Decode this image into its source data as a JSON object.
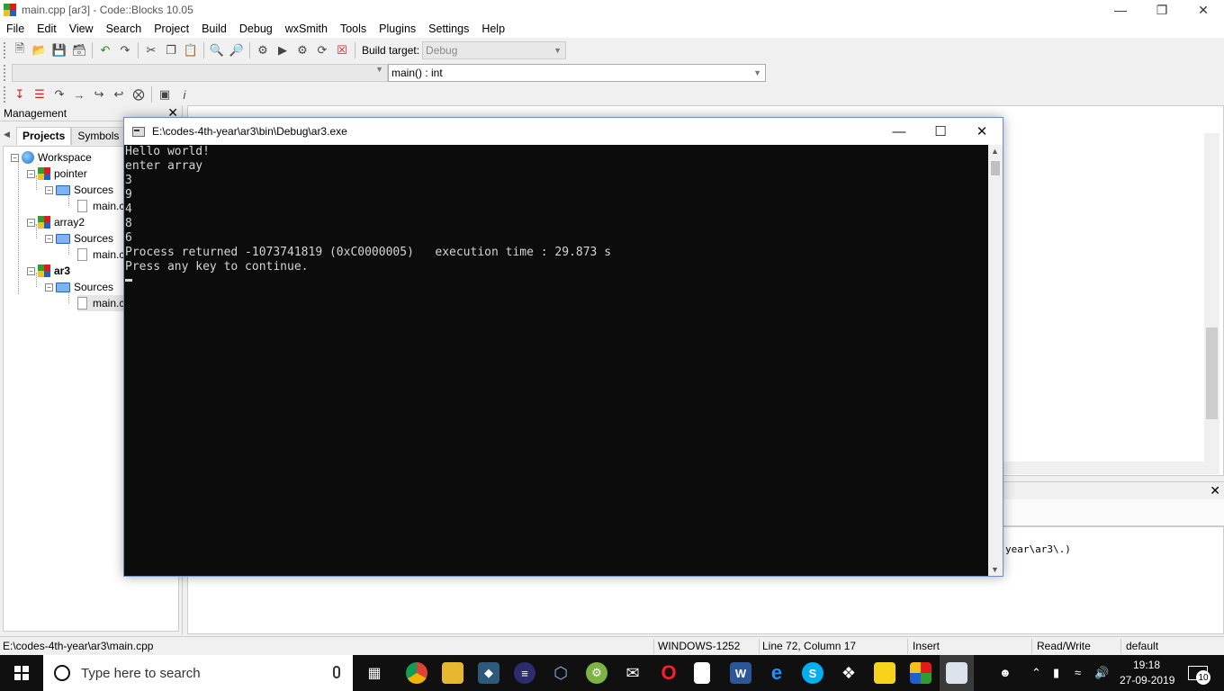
{
  "window": {
    "title": "main.cpp [ar3] - Code::Blocks 10.05"
  },
  "menu": [
    "File",
    "Edit",
    "View",
    "Search",
    "Project",
    "Build",
    "Debug",
    "wxSmith",
    "Tools",
    "Plugins",
    "Settings",
    "Help"
  ],
  "toolbar": {
    "build_target_label": "Build target:",
    "build_target_value": "Debug",
    "function_value": "main() : int"
  },
  "management": {
    "title": "Management",
    "tabs": [
      "Projects",
      "Symbols"
    ],
    "tree": {
      "workspace": "Workspace",
      "projects": [
        {
          "name": "pointer",
          "folder": "Sources",
          "file": "main.c"
        },
        {
          "name": "array2",
          "folder": "Sources",
          "file": "main.c"
        },
        {
          "name": "ar3",
          "folder": "Sources",
          "file": "main.c"
        }
      ]
    }
  },
  "console": {
    "title": "E:\\codes-4th-year\\ar3\\bin\\Debug\\ar3.exe",
    "lines": [
      "Hello world!",
      "enter array",
      "3",
      "9",
      "4",
      "8",
      "6",
      "",
      "Process returned -1073741819 (0xC0000005)   execution time : 29.873 s",
      "Press any key to continue."
    ]
  },
  "log": {
    "snippet": "year\\ar3\\.)"
  },
  "statusbar": {
    "path": "E:\\codes-4th-year\\ar3\\main.cpp",
    "encoding": "WINDOWS-1252",
    "position": "Line 72, Column 17",
    "mode": "Insert",
    "access": "Read/Write",
    "lang": "default"
  },
  "taskbar": {
    "search_placeholder": "Type here to search",
    "time": "19:18",
    "date": "27-09-2019",
    "notifications": "10"
  },
  "colors": {
    "console_bg": "#0c0c0c",
    "console_text": "#d4d4d4",
    "taskbar_bg": "#101010"
  }
}
